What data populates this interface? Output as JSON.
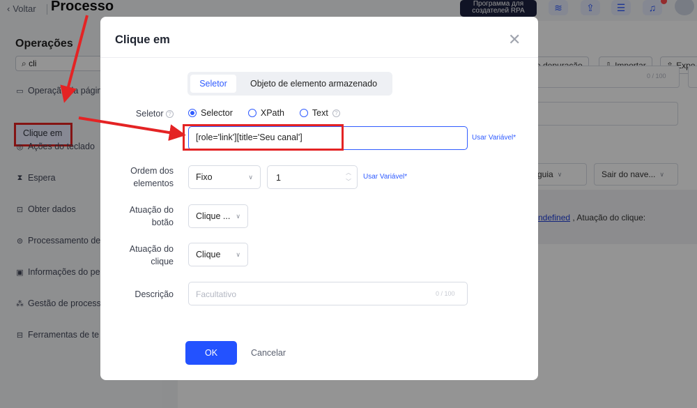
{
  "topbar": {
    "back_label": "Voltar",
    "page_title": "Processo",
    "banner_line1": "Программа для",
    "banner_line2": "создателей RPA"
  },
  "sidebar": {
    "title": "Operações",
    "search_value": "cli",
    "items": [
      {
        "label": "Operação da págin",
        "icon": "browser-icon"
      },
      {
        "label": "Clique em",
        "icon": ""
      },
      {
        "label": "Ações do teclado",
        "icon": "keyboard-icon"
      },
      {
        "label": "Espera",
        "icon": "hourglass-icon"
      },
      {
        "label": "Obter dados",
        "icon": "data-icon"
      },
      {
        "label": "Processamento de",
        "icon": "database-icon"
      },
      {
        "label": "Informações do pe",
        "icon": "info-icon"
      },
      {
        "label": "Gestão de process",
        "icon": "process-icon"
      },
      {
        "label": "Ferramentas de te",
        "icon": "tools-icon"
      }
    ]
  },
  "right_panel": {
    "debug_label": "e depuração",
    "import_label": "Importar",
    "export_label": "Expo",
    "count_text": "0 / 100",
    "tab_select_label": "guia",
    "exit_select_label": "Sair do nave...",
    "summary_link": "ndefined",
    "summary_text": ", Atuação do clique:"
  },
  "modal": {
    "title": "Clique em",
    "tabs": {
      "selector": "Seletor",
      "stored_object": "Objeto de elemento armazenado"
    },
    "labels": {
      "selector": "Seletor",
      "order_line1": "Ordem dos",
      "order_line2": "elementos",
      "button_line1": "Atuação do",
      "button_line2": "botão",
      "click_line1": "Atuação do",
      "click_line2": "clique",
      "description": "Descrição"
    },
    "radios": {
      "selector": "Selector",
      "xpath": "XPath",
      "text": "Text",
      "selected": "Selector"
    },
    "selector_value": "[role='link'][title='Seu canal']",
    "use_variable": "Usar Variável*",
    "order_type": "Fixo",
    "order_value": "1",
    "button_action": "Clique ...",
    "click_action": "Clique",
    "description_placeholder": "Facultativo",
    "description_count": "0 / 100",
    "ok_label": "OK",
    "cancel_label": "Cancelar"
  },
  "colors": {
    "accent": "#2f5bff",
    "primary_button": "#2352ff",
    "annotation_red": "#e42324"
  }
}
